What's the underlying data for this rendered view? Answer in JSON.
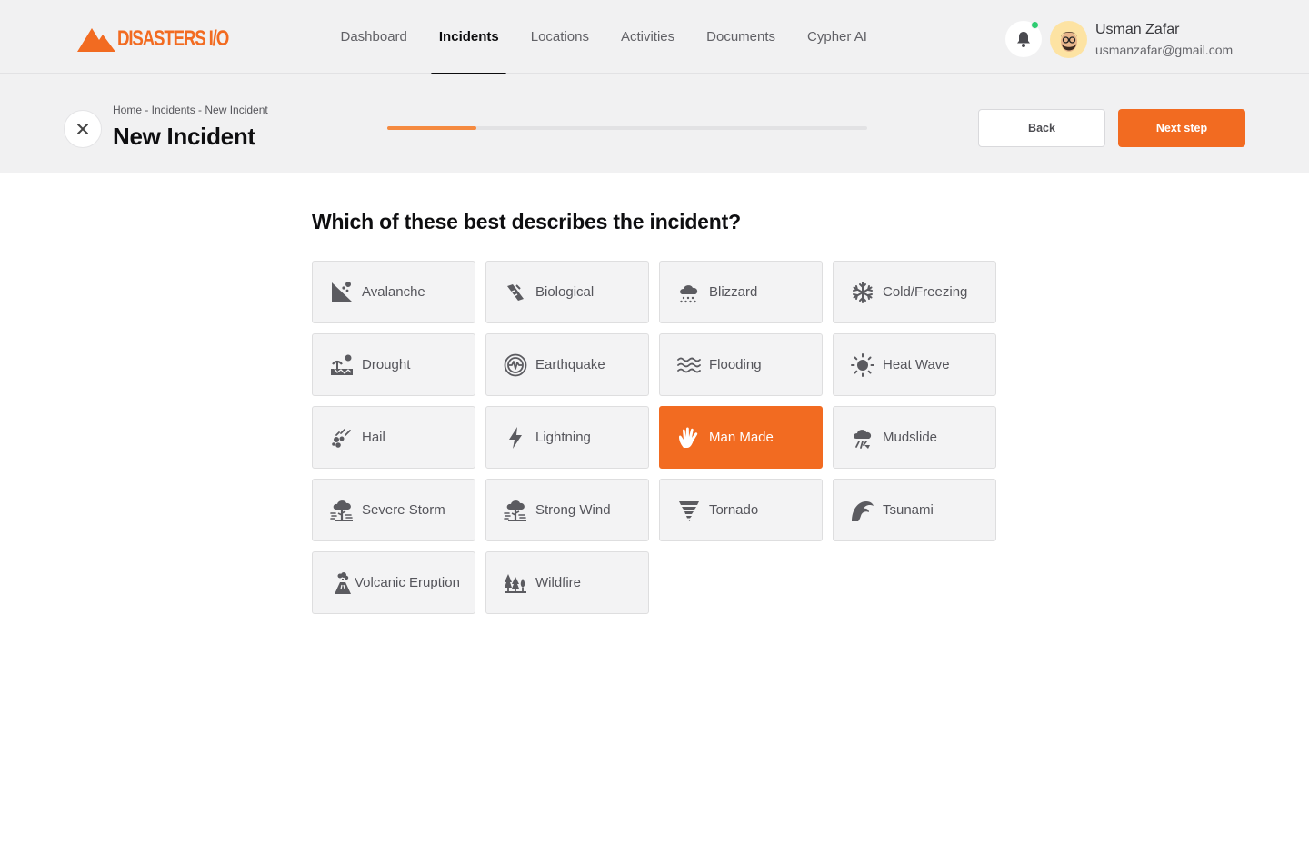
{
  "brand": {
    "name": "DISASTERS I/O",
    "accent_color": "#f26b21"
  },
  "nav": {
    "items": [
      {
        "label": "Dashboard",
        "active": false
      },
      {
        "label": "Incidents",
        "active": true
      },
      {
        "label": "Locations",
        "active": false
      },
      {
        "label": "Activities",
        "active": false
      },
      {
        "label": "Documents",
        "active": false
      },
      {
        "label": "Cypher AI",
        "active": false
      }
    ]
  },
  "user": {
    "name": "Usman Zafar",
    "email": "usmanzafar@gmail.com",
    "notification_icon": "bell-icon",
    "status_color": "#2ecc71"
  },
  "header": {
    "breadcrumb": "Home - Incidents - New Incident",
    "title": "New Incident",
    "progress_percent": 18.5,
    "back_label": "Back",
    "next_label": "Next step"
  },
  "question": "Which of these best describes the incident?",
  "incident_types": [
    {
      "label": "Avalanche",
      "icon": "avalanche-icon",
      "selected": false
    },
    {
      "label": "Biological",
      "icon": "biological-icon",
      "selected": false
    },
    {
      "label": "Blizzard",
      "icon": "blizzard-icon",
      "selected": false
    },
    {
      "label": "Cold/Freezing",
      "icon": "snowflake-icon",
      "selected": false
    },
    {
      "label": "Drought",
      "icon": "drought-icon",
      "selected": false
    },
    {
      "label": "Earthquake",
      "icon": "earthquake-icon",
      "selected": false
    },
    {
      "label": "Flooding",
      "icon": "flooding-icon",
      "selected": false
    },
    {
      "label": "Heat Wave",
      "icon": "sun-icon",
      "selected": false
    },
    {
      "label": "Hail",
      "icon": "hail-icon",
      "selected": false
    },
    {
      "label": "Lightning",
      "icon": "lightning-icon",
      "selected": false
    },
    {
      "label": "Man Made",
      "icon": "hand-icon",
      "selected": true
    },
    {
      "label": "Mudslide",
      "icon": "mudslide-icon",
      "selected": false
    },
    {
      "label": "Severe Storm",
      "icon": "severe-storm-icon",
      "selected": false
    },
    {
      "label": "Strong Wind",
      "icon": "strong-wind-icon",
      "selected": false
    },
    {
      "label": "Tornado",
      "icon": "tornado-icon",
      "selected": false
    },
    {
      "label": "Tsunami",
      "icon": "tsunami-icon",
      "selected": false
    },
    {
      "label": "Volcanic Eruption",
      "icon": "volcano-icon",
      "selected": false
    },
    {
      "label": "Wildfire",
      "icon": "wildfire-icon",
      "selected": false
    }
  ]
}
